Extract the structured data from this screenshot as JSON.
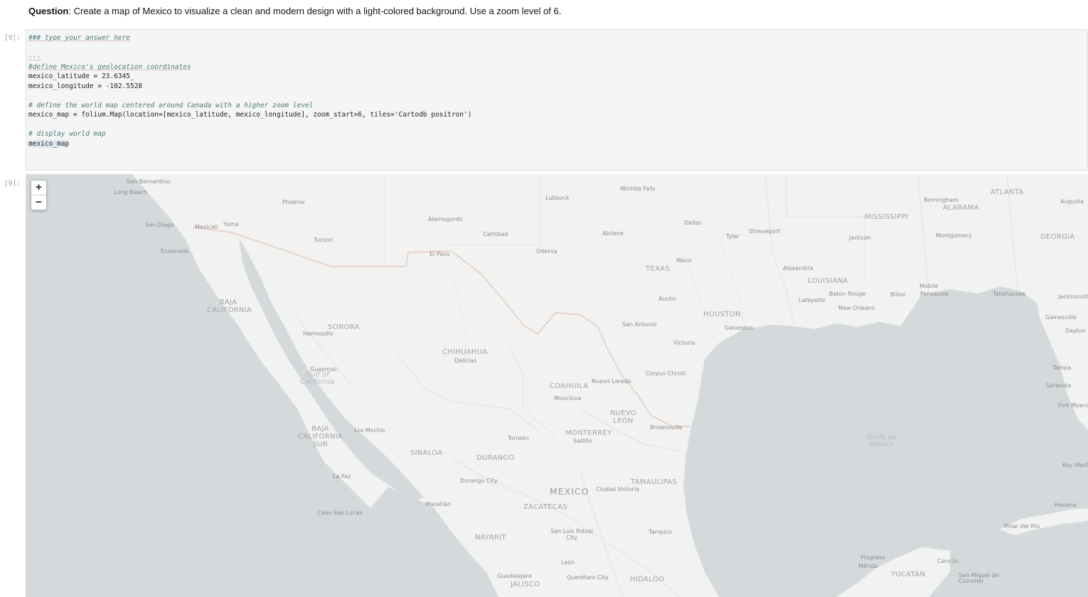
{
  "question": {
    "prefix": "Question",
    "text": ": Create a map of Mexico to visualize a clean and modern design with a light-colored background. Use a zoom level of 6."
  },
  "cell": {
    "input_prompt": "[9]:",
    "output_prompt": "[9]:",
    "code_lines": [
      "### type your answer here",
      "",
      "---",
      "#define Mexico's geolocation coordinates",
      "mexico_latitude = 23.6345_",
      "mexico_longitude = -102.5528",
      "",
      "# define the world map centered around Canada with a higher zoom level",
      "mexico_map = folium.Map(location=[mexico_latitude, mexico_longitude], zoom_start=6, tiles='Cartodb positron')",
      "",
      "# display world map",
      "mexico_map"
    ]
  },
  "map": {
    "zoom_in": "+",
    "zoom_out": "−",
    "land_color": "#f2f2f0",
    "water_color": "#d4dadc",
    "border_color": "#e8c9c9",
    "cities": [
      "San Bernardino",
      "Long Beach",
      "Phoenix",
      "San Diego",
      "Mexicali",
      "Yuma",
      "Tucson",
      "Ensenada",
      "Alamogordo",
      "Carlsbad",
      "El Paso",
      "Lubbock",
      "Wichita Falls",
      "Odessa",
      "Abilene",
      "Dallas",
      "Tyler",
      "Shreveport",
      "Waco",
      "Austin",
      "San Antonio",
      "Victoria",
      "Corpus Christi",
      "Nuevo Laredo",
      "Brownsville",
      "Hermosillo",
      "Guaymas",
      "Delicias",
      "Monclova",
      "Los Mochis",
      "Torreón",
      "Saltillo",
      "La Paz",
      "Durango City",
      "Ciudad Victoria",
      "Mazatlán",
      "Cabo San Lucas",
      "San Luis Potosí City",
      "Tampico",
      "León",
      "Guadalajara",
      "Querétaro City",
      "Birmingham",
      "Montgomery",
      "Jackson",
      "Alexandria",
      "Baton Rouge",
      "Lafayette",
      "New Orleans",
      "Mobile",
      "Biloxi",
      "Pensacola",
      "Tallahassee",
      "Gainesville",
      "Tampa",
      "Sarasota",
      "Fort Myers",
      "Key West",
      "Havana",
      "Pinar del Río",
      "Progreso",
      "Mérida",
      "Cancún",
      "San Miguel de Cozumel",
      "Galveston",
      "Jacksonville",
      "Dayton",
      "Augusta"
    ],
    "regions": [
      "BAJA CALIFORNIA",
      "SONORA",
      "CHIHUAHUA",
      "COAHUILA",
      "NUEVO LEÓN",
      "BAJA CALIFORNIA SUR",
      "SINALOA",
      "DURANGO",
      "TAMAULIPAS",
      "ZACATECAS",
      "NAYARIT",
      "JALISCO",
      "HIDALGO",
      "YUCATÁN",
      "TEXAS",
      "LOUISIANA",
      "MISSISSIPPI",
      "ALABAMA",
      "GEORGIA",
      "MONTERREY",
      "HOUSTON",
      "ATLANTA"
    ],
    "country": "MEXICO",
    "water": [
      "Gulf of California",
      "Golfo de México"
    ]
  }
}
